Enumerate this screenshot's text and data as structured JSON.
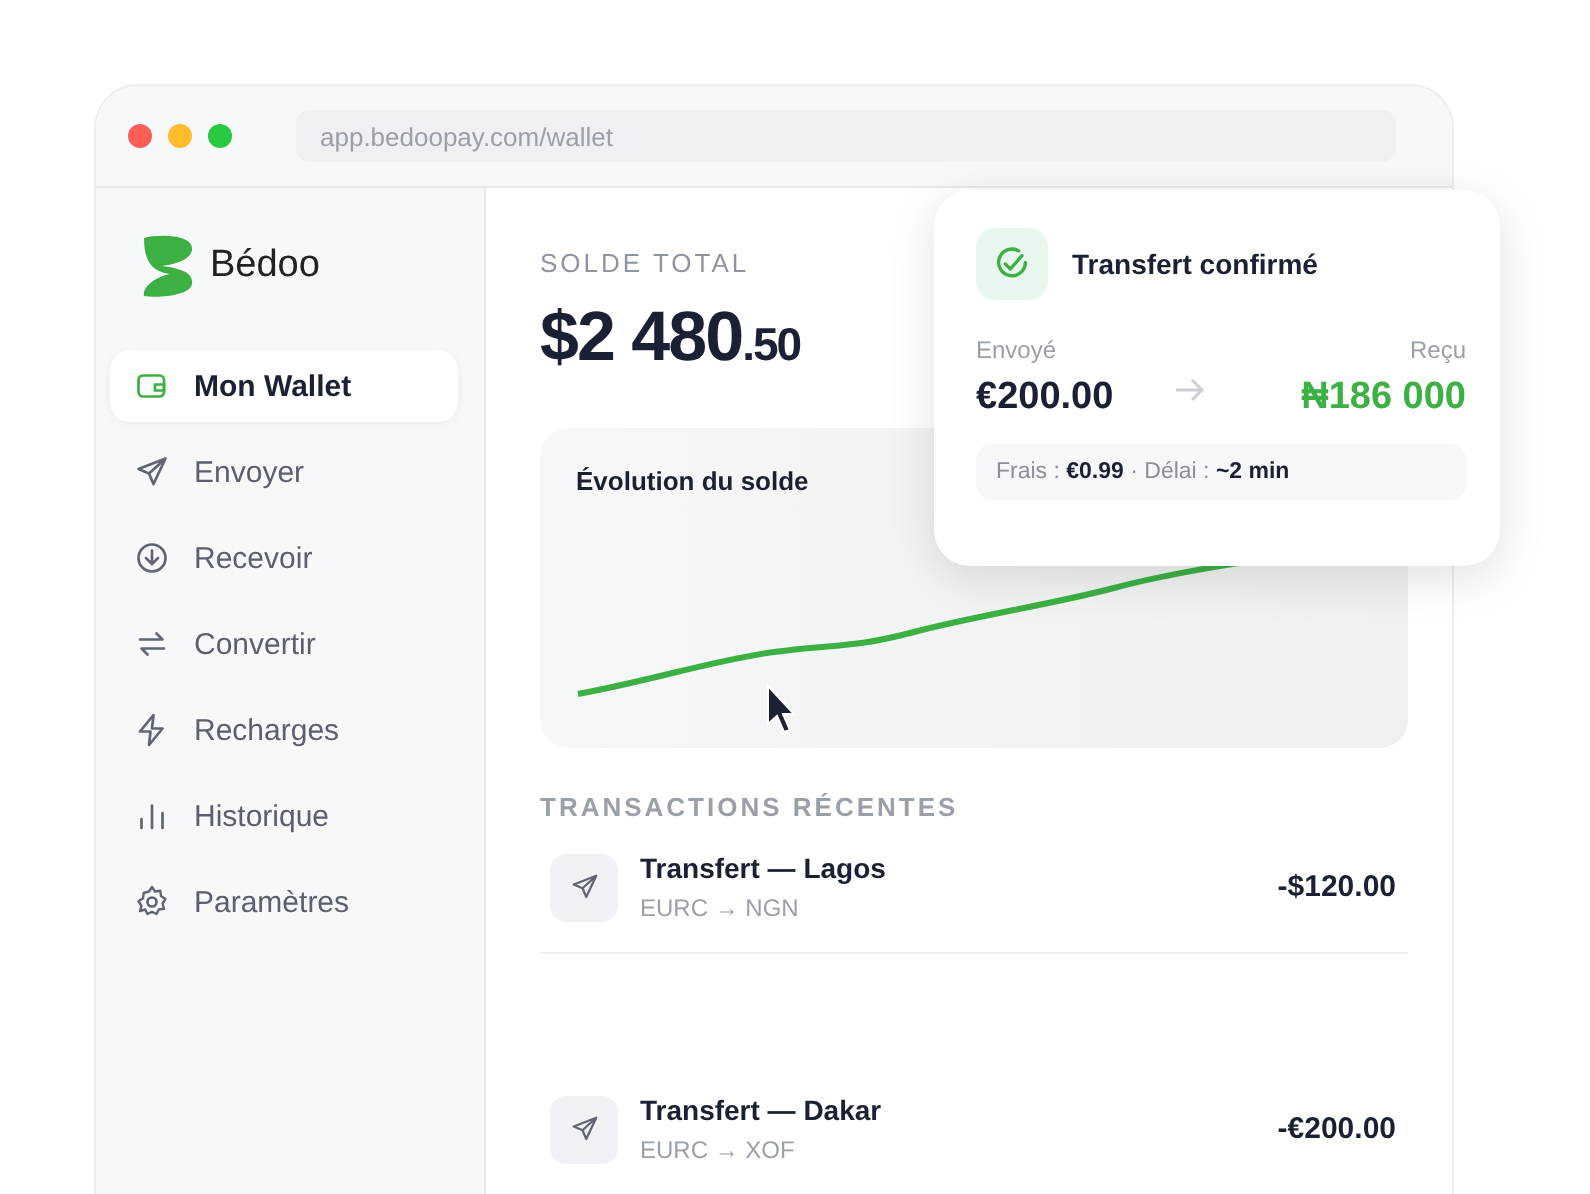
{
  "browser": {
    "url": "app.bedoopay.com/wallet"
  },
  "sidebar": {
    "brand": "Bédoo",
    "items": [
      {
        "label": "Mon Wallet",
        "selected": true
      },
      {
        "label": "Envoyer",
        "selected": false
      },
      {
        "label": "Recevoir",
        "selected": false
      },
      {
        "label": "Convertir",
        "selected": false
      },
      {
        "label": "Recharges",
        "selected": false
      },
      {
        "label": "Historique",
        "selected": false
      },
      {
        "label": "Paramètres",
        "selected": false
      }
    ]
  },
  "balance": {
    "label": "SOLDE TOTAL",
    "whole": "$2 480",
    "cents": ".50"
  },
  "chart": {
    "title": "Évolution du solde"
  },
  "transactions": {
    "heading": "TRANSACTIONS RÉCENTES",
    "rows": [
      {
        "title": "Transfert — Lagos",
        "subtitle": "EURC → NGN",
        "amount": "-$120.00"
      },
      {
        "title": "Transfert — Dakar",
        "subtitle": "EURC → XOF",
        "amount": "-€200.00"
      }
    ]
  },
  "toast": {
    "title": "Transfert confirmé",
    "sent_label": "Envoyé",
    "sent": "€200.00",
    "received_label": "Reçu",
    "received": "₦186 000",
    "details": "Frais : **€0.99** · Délai : **~2 min**"
  }
}
